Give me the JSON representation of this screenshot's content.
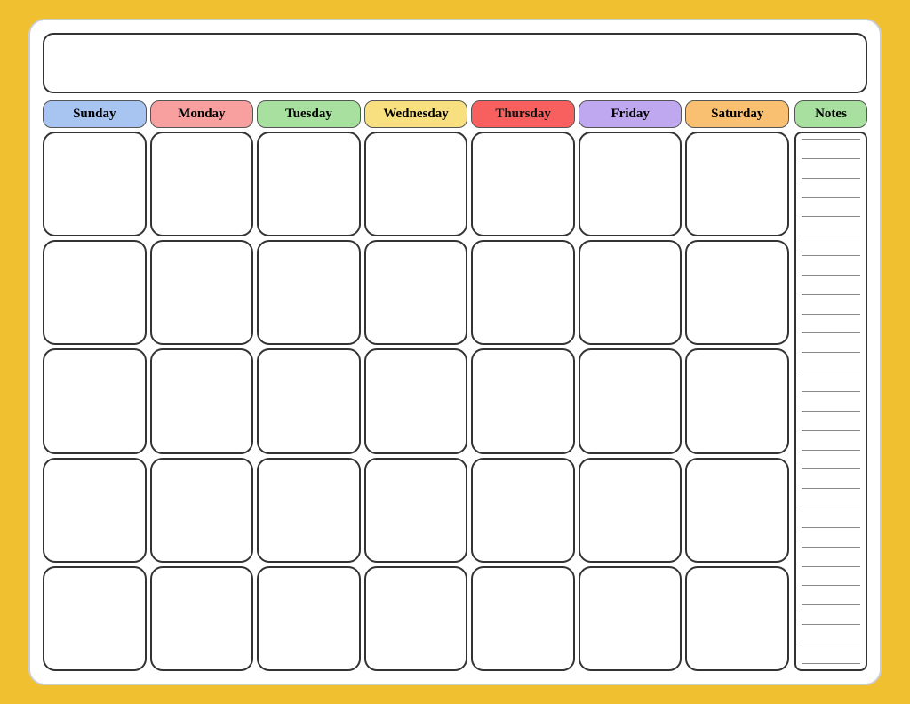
{
  "calendar": {
    "title": "",
    "days": [
      "Sunday",
      "Monday",
      "Tuesday",
      "Wednesday",
      "Thursday",
      "Friday",
      "Saturday"
    ],
    "day_classes": [
      "sunday",
      "monday",
      "tuesday",
      "wednesday",
      "thursday",
      "friday",
      "saturday"
    ],
    "notes_label": "Notes",
    "num_weeks": 5,
    "num_note_lines": 28
  }
}
